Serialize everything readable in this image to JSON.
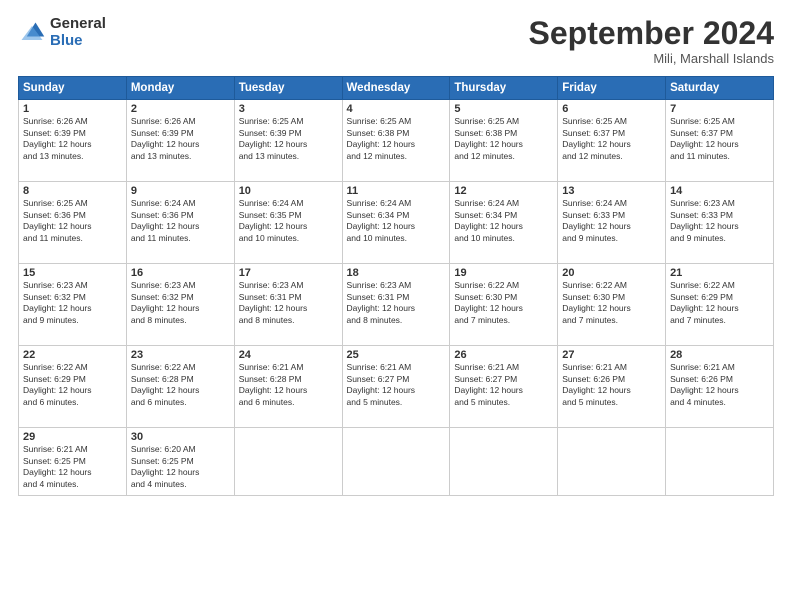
{
  "header": {
    "logo_general": "General",
    "logo_blue": "Blue",
    "month": "September 2024",
    "location": "Mili, Marshall Islands"
  },
  "weekdays": [
    "Sunday",
    "Monday",
    "Tuesday",
    "Wednesday",
    "Thursday",
    "Friday",
    "Saturday"
  ],
  "weeks": [
    [
      {
        "day": "1",
        "lines": [
          "Sunrise: 6:26 AM",
          "Sunset: 6:39 PM",
          "Daylight: 12 hours",
          "and 13 minutes."
        ]
      },
      {
        "day": "2",
        "lines": [
          "Sunrise: 6:26 AM",
          "Sunset: 6:39 PM",
          "Daylight: 12 hours",
          "and 13 minutes."
        ]
      },
      {
        "day": "3",
        "lines": [
          "Sunrise: 6:25 AM",
          "Sunset: 6:39 PM",
          "Daylight: 12 hours",
          "and 13 minutes."
        ]
      },
      {
        "day": "4",
        "lines": [
          "Sunrise: 6:25 AM",
          "Sunset: 6:38 PM",
          "Daylight: 12 hours",
          "and 12 minutes."
        ]
      },
      {
        "day": "5",
        "lines": [
          "Sunrise: 6:25 AM",
          "Sunset: 6:38 PM",
          "Daylight: 12 hours",
          "and 12 minutes."
        ]
      },
      {
        "day": "6",
        "lines": [
          "Sunrise: 6:25 AM",
          "Sunset: 6:37 PM",
          "Daylight: 12 hours",
          "and 12 minutes."
        ]
      },
      {
        "day": "7",
        "lines": [
          "Sunrise: 6:25 AM",
          "Sunset: 6:37 PM",
          "Daylight: 12 hours",
          "and 11 minutes."
        ]
      }
    ],
    [
      {
        "day": "8",
        "lines": [
          "Sunrise: 6:25 AM",
          "Sunset: 6:36 PM",
          "Daylight: 12 hours",
          "and 11 minutes."
        ]
      },
      {
        "day": "9",
        "lines": [
          "Sunrise: 6:24 AM",
          "Sunset: 6:36 PM",
          "Daylight: 12 hours",
          "and 11 minutes."
        ]
      },
      {
        "day": "10",
        "lines": [
          "Sunrise: 6:24 AM",
          "Sunset: 6:35 PM",
          "Daylight: 12 hours",
          "and 10 minutes."
        ]
      },
      {
        "day": "11",
        "lines": [
          "Sunrise: 6:24 AM",
          "Sunset: 6:34 PM",
          "Daylight: 12 hours",
          "and 10 minutes."
        ]
      },
      {
        "day": "12",
        "lines": [
          "Sunrise: 6:24 AM",
          "Sunset: 6:34 PM",
          "Daylight: 12 hours",
          "and 10 minutes."
        ]
      },
      {
        "day": "13",
        "lines": [
          "Sunrise: 6:24 AM",
          "Sunset: 6:33 PM",
          "Daylight: 12 hours",
          "and 9 minutes."
        ]
      },
      {
        "day": "14",
        "lines": [
          "Sunrise: 6:23 AM",
          "Sunset: 6:33 PM",
          "Daylight: 12 hours",
          "and 9 minutes."
        ]
      }
    ],
    [
      {
        "day": "15",
        "lines": [
          "Sunrise: 6:23 AM",
          "Sunset: 6:32 PM",
          "Daylight: 12 hours",
          "and 9 minutes."
        ]
      },
      {
        "day": "16",
        "lines": [
          "Sunrise: 6:23 AM",
          "Sunset: 6:32 PM",
          "Daylight: 12 hours",
          "and 8 minutes."
        ]
      },
      {
        "day": "17",
        "lines": [
          "Sunrise: 6:23 AM",
          "Sunset: 6:31 PM",
          "Daylight: 12 hours",
          "and 8 minutes."
        ]
      },
      {
        "day": "18",
        "lines": [
          "Sunrise: 6:23 AM",
          "Sunset: 6:31 PM",
          "Daylight: 12 hours",
          "and 8 minutes."
        ]
      },
      {
        "day": "19",
        "lines": [
          "Sunrise: 6:22 AM",
          "Sunset: 6:30 PM",
          "Daylight: 12 hours",
          "and 7 minutes."
        ]
      },
      {
        "day": "20",
        "lines": [
          "Sunrise: 6:22 AM",
          "Sunset: 6:30 PM",
          "Daylight: 12 hours",
          "and 7 minutes."
        ]
      },
      {
        "day": "21",
        "lines": [
          "Sunrise: 6:22 AM",
          "Sunset: 6:29 PM",
          "Daylight: 12 hours",
          "and 7 minutes."
        ]
      }
    ],
    [
      {
        "day": "22",
        "lines": [
          "Sunrise: 6:22 AM",
          "Sunset: 6:29 PM",
          "Daylight: 12 hours",
          "and 6 minutes."
        ]
      },
      {
        "day": "23",
        "lines": [
          "Sunrise: 6:22 AM",
          "Sunset: 6:28 PM",
          "Daylight: 12 hours",
          "and 6 minutes."
        ]
      },
      {
        "day": "24",
        "lines": [
          "Sunrise: 6:21 AM",
          "Sunset: 6:28 PM",
          "Daylight: 12 hours",
          "and 6 minutes."
        ]
      },
      {
        "day": "25",
        "lines": [
          "Sunrise: 6:21 AM",
          "Sunset: 6:27 PM",
          "Daylight: 12 hours",
          "and 5 minutes."
        ]
      },
      {
        "day": "26",
        "lines": [
          "Sunrise: 6:21 AM",
          "Sunset: 6:27 PM",
          "Daylight: 12 hours",
          "and 5 minutes."
        ]
      },
      {
        "day": "27",
        "lines": [
          "Sunrise: 6:21 AM",
          "Sunset: 6:26 PM",
          "Daylight: 12 hours",
          "and 5 minutes."
        ]
      },
      {
        "day": "28",
        "lines": [
          "Sunrise: 6:21 AM",
          "Sunset: 6:26 PM",
          "Daylight: 12 hours",
          "and 4 minutes."
        ]
      }
    ],
    [
      {
        "day": "29",
        "lines": [
          "Sunrise: 6:21 AM",
          "Sunset: 6:25 PM",
          "Daylight: 12 hours",
          "and 4 minutes."
        ]
      },
      {
        "day": "30",
        "lines": [
          "Sunrise: 6:20 AM",
          "Sunset: 6:25 PM",
          "Daylight: 12 hours",
          "and 4 minutes."
        ]
      },
      {
        "day": "",
        "lines": []
      },
      {
        "day": "",
        "lines": []
      },
      {
        "day": "",
        "lines": []
      },
      {
        "day": "",
        "lines": []
      },
      {
        "day": "",
        "lines": []
      }
    ]
  ]
}
